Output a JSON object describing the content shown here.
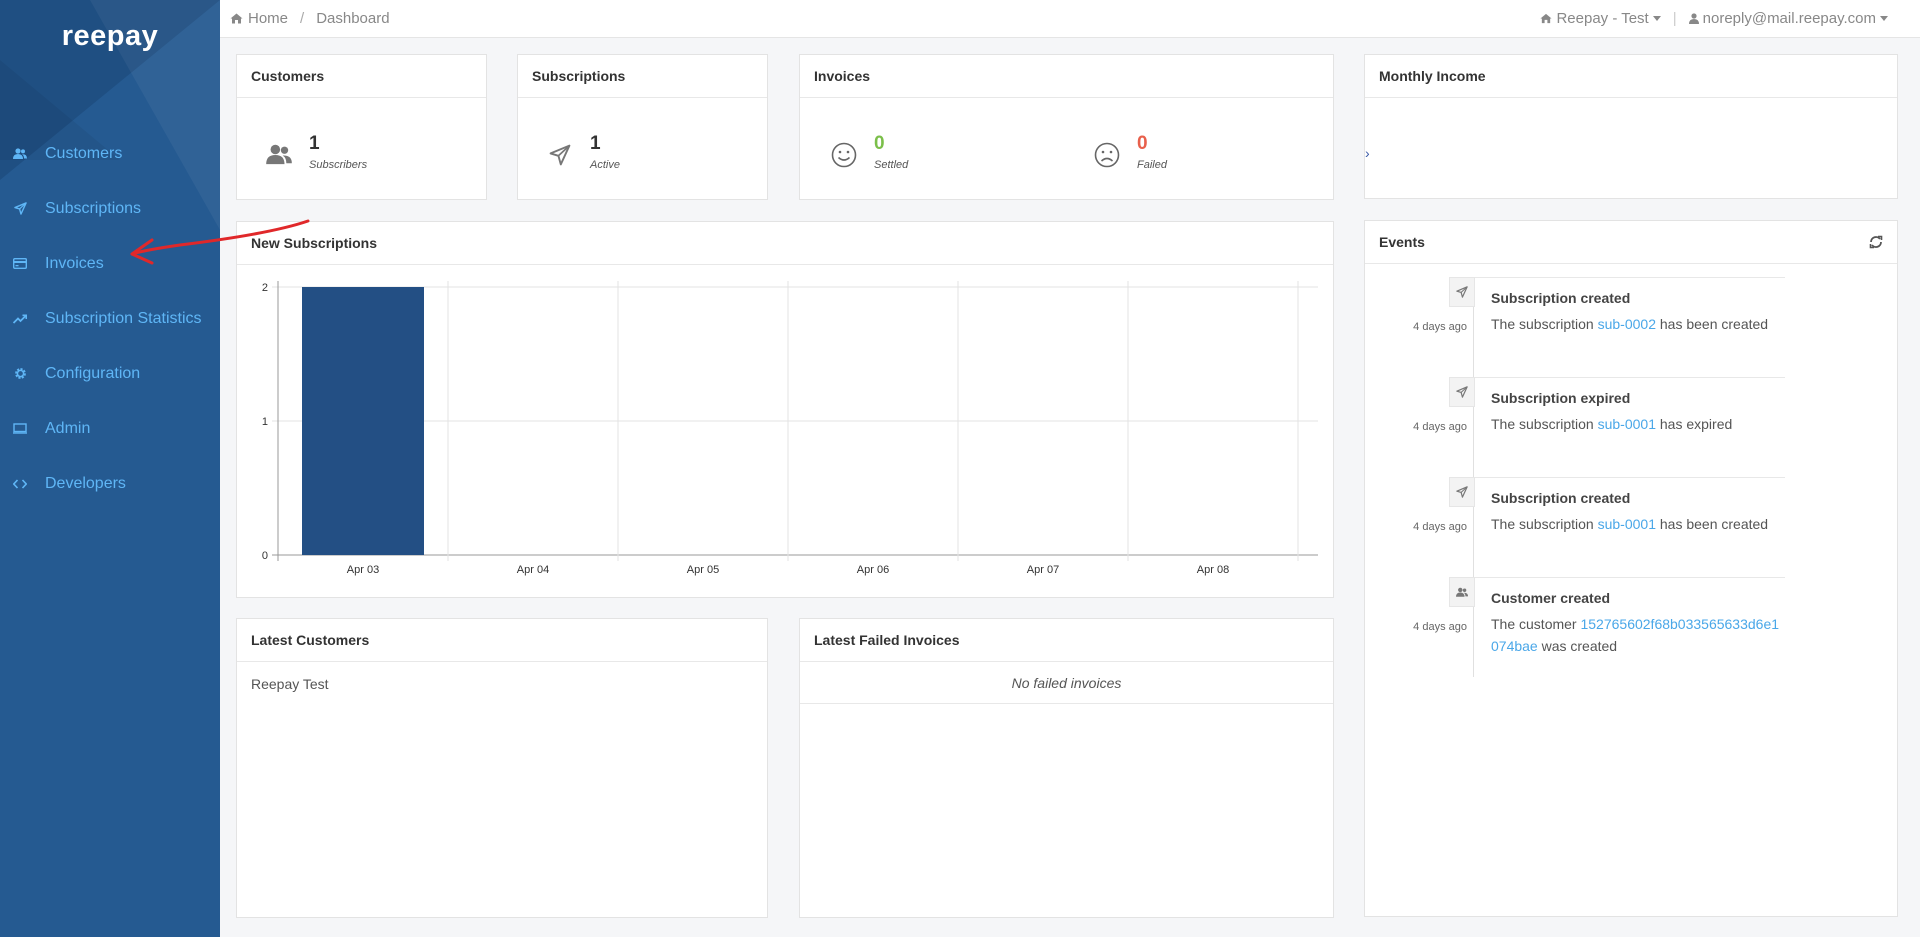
{
  "brand": {
    "logo": "reepay"
  },
  "nav": {
    "items": [
      {
        "label": "Customers",
        "icon": "users-icon"
      },
      {
        "label": "Subscriptions",
        "icon": "paper-plane-icon"
      },
      {
        "label": "Invoices",
        "icon": "credit-card-icon"
      },
      {
        "label": "Subscription Statistics",
        "icon": "trend-icon"
      },
      {
        "label": "Configuration",
        "icon": "gear-icon"
      },
      {
        "label": "Admin",
        "icon": "monitor-icon"
      },
      {
        "label": "Developers",
        "icon": "code-icon"
      }
    ]
  },
  "topbar": {
    "home": "Home",
    "separator": "/",
    "current": "Dashboard",
    "account": "Reepay - Test",
    "user": "noreply@mail.reepay.com"
  },
  "panels": {
    "customers": {
      "title": "Customers",
      "value": "1",
      "label": "Subscribers"
    },
    "subscriptions": {
      "title": "Subscriptions",
      "value": "1",
      "label": "Active"
    },
    "invoices": {
      "title": "Invoices",
      "settled_value": "0",
      "settled_label": "Settled",
      "failed_value": "0",
      "failed_label": "Failed"
    },
    "monthly_income": {
      "title": "Monthly Income",
      "chevron": "›"
    },
    "new_subscriptions": {
      "title": "New Subscriptions"
    },
    "latest_customers": {
      "title": "Latest Customers",
      "items": [
        "Reepay Test"
      ]
    },
    "latest_failed": {
      "title": "Latest Failed Invoices",
      "empty": "No failed invoices"
    },
    "events": {
      "title": "Events",
      "items": [
        {
          "icon": "paper-plane-icon",
          "time": "4 days ago",
          "title": "Subscription created",
          "pre": "The subscription ",
          "link": "sub-0002",
          "post": " has been created"
        },
        {
          "icon": "paper-plane-icon",
          "time": "4 days ago",
          "title": "Subscription expired",
          "pre": "The subscription ",
          "link": "sub-0001",
          "post": " has expired"
        },
        {
          "icon": "paper-plane-icon",
          "time": "4 days ago",
          "title": "Subscription created",
          "pre": "The subscription ",
          "link": "sub-0001",
          "post": " has been created"
        },
        {
          "icon": "users-icon",
          "time": "4 days ago",
          "title": "Customer created",
          "pre": "The customer ",
          "link": "152765602f68b033565633d6e1074bae",
          "post": " was created"
        }
      ]
    }
  },
  "colors": {
    "sidebar": "#255a91",
    "bar": "#234f84",
    "link": "#4aa7e8",
    "settled": "#7bbf4a",
    "failed": "#e8604c"
  },
  "chart_data": {
    "type": "bar",
    "categories": [
      "Apr 03",
      "Apr 04",
      "Apr 05",
      "Apr 06",
      "Apr 07",
      "Apr 08"
    ],
    "values": [
      2,
      0,
      0,
      0,
      0,
      0
    ],
    "title": "New Subscriptions",
    "xlabel": "",
    "ylabel": "",
    "ylim": [
      0,
      2
    ],
    "yticks": [
      0,
      1,
      2
    ],
    "grid": true
  }
}
